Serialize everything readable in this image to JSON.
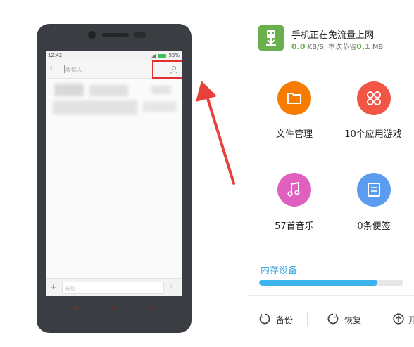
{
  "phone": {
    "status_time": "12:42",
    "status_battery": "93%",
    "sms_recipient_placeholder": "收信人",
    "sms_input_placeholder": "短信",
    "nav_menu_glyph": "≡",
    "nav_home_glyph": "⌂",
    "nav_back_glyph": "↶"
  },
  "connection": {
    "title": "手机正在免流量上网",
    "speed_value": "0.0",
    "speed_unit_text": " KB/S, 本次节省",
    "saved_value": "0.1",
    "saved_unit": " MB"
  },
  "tiles": [
    {
      "label": "文件管理",
      "icon": "folder-icon",
      "color": "#f57c00"
    },
    {
      "label": "10个应用游戏",
      "icon": "apps-grid-icon",
      "color": "#f05545"
    },
    {
      "label": "57首音乐",
      "icon": "music-note-icon",
      "color": "#e060c0"
    },
    {
      "label": "0条便签",
      "icon": "note-icon",
      "color": "#5b9bf0"
    }
  ],
  "storage": {
    "label": "内存设备",
    "used_fraction": 0.82
  },
  "actions": {
    "backup_label": "备份",
    "restore_label": "恢复",
    "upload_label": "开"
  },
  "colors": {
    "accent_blue": "#3ab4ea",
    "highlight_red": "#e03030",
    "connection_green": "#6ab04c"
  }
}
